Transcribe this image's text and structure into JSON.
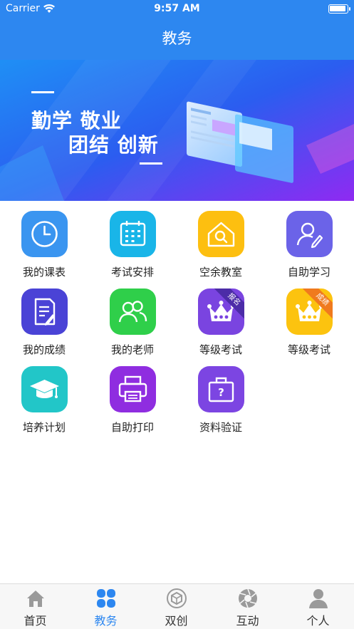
{
  "status_bar": {
    "carrier": "Carrier",
    "time": "9:57 AM"
  },
  "nav": {
    "title": "教务"
  },
  "banner": {
    "line1": "勤学 敬业",
    "line2": "团结 创新"
  },
  "grid": {
    "items": [
      {
        "label": "我的课表",
        "icon": "clock-icon",
        "color": "#3a95f0"
      },
      {
        "label": "考试安排",
        "icon": "calendar-icon",
        "color": "#19b5e8"
      },
      {
        "label": "空余教室",
        "icon": "house-search-icon",
        "color": "#fdbf10"
      },
      {
        "label": "自助学习",
        "icon": "user-pencil-icon",
        "color": "#6b63e8"
      },
      {
        "label": "我的成绩",
        "icon": "document-pen-icon",
        "color": "#4a43d6"
      },
      {
        "label": "我的老师",
        "icon": "users-icon",
        "color": "#2fcf4a"
      },
      {
        "label": "等级考试",
        "icon": "crown-icon",
        "color": "#7a44e0",
        "badge": "报名"
      },
      {
        "label": "等级考试",
        "icon": "crown-icon",
        "color": "#fcc30f",
        "badge": "成绩"
      },
      {
        "label": "培养计划",
        "icon": "graduation-cap-icon",
        "color": "#22c6c8"
      },
      {
        "label": "自助打印",
        "icon": "printer-icon",
        "color": "#8f2de0"
      },
      {
        "label": "资料验证",
        "icon": "question-bag-icon",
        "color": "#7c45e2"
      }
    ]
  },
  "tabbar": {
    "items": [
      {
        "label": "首页",
        "icon": "home-icon"
      },
      {
        "label": "教务",
        "icon": "grid-icon",
        "active": true
      },
      {
        "label": "双创",
        "icon": "cube-icon"
      },
      {
        "label": "互动",
        "icon": "shutter-icon"
      },
      {
        "label": "个人",
        "icon": "person-icon"
      }
    ]
  },
  "colors": {
    "primary": "#2d87f0",
    "tab_inactive": "#9a9a9a"
  }
}
